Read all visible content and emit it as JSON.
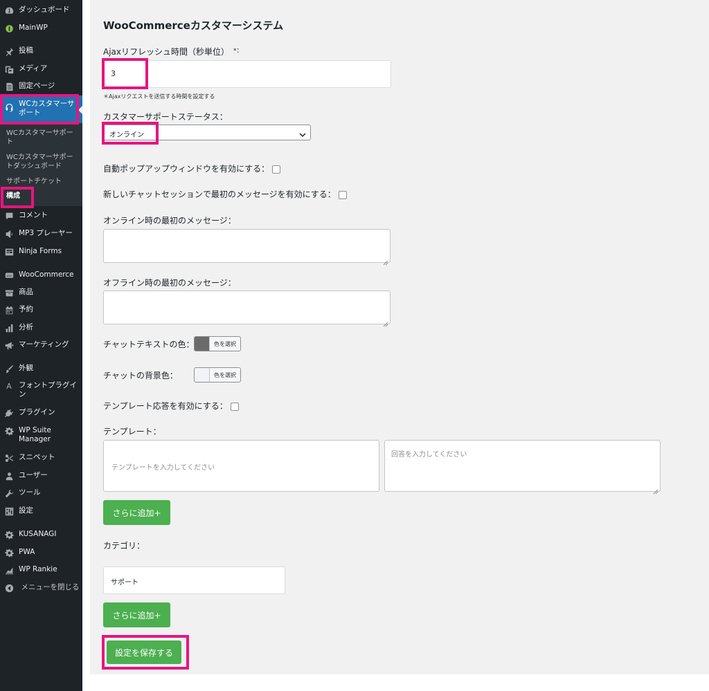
{
  "sidebar": {
    "items": [
      {
        "label": "ダッシュボード",
        "icon": "dashboard-icon"
      },
      {
        "label": "MainWP",
        "icon": "mainwp-icon"
      },
      {
        "label": "投稿",
        "icon": "pin-icon"
      },
      {
        "label": "メディア",
        "icon": "media-icon"
      },
      {
        "label": "固定ページ",
        "icon": "page-icon"
      },
      {
        "label": "WCカスタマーサポート",
        "icon": "headset-icon"
      },
      {
        "label": "コメント",
        "icon": "comment-icon"
      },
      {
        "label": "MP3 プレーヤー",
        "icon": "audio-icon"
      },
      {
        "label": "Ninja Forms",
        "icon": "forms-icon"
      },
      {
        "label": "WooCommerce",
        "icon": "woo-icon"
      },
      {
        "label": "商品",
        "icon": "archive-icon"
      },
      {
        "label": "予約",
        "icon": "calendar-icon"
      },
      {
        "label": "分析",
        "icon": "bar-chart-icon"
      },
      {
        "label": "マーケティング",
        "icon": "megaphone-icon"
      },
      {
        "label": "外観",
        "icon": "brush-icon"
      },
      {
        "label": "フォントプラグイン",
        "icon": "font-icon"
      },
      {
        "label": "プラグイン",
        "icon": "plugin-icon"
      },
      {
        "label": "WP Suite Manager",
        "icon": "gear-icon"
      },
      {
        "label": "スニペット",
        "icon": "scissors-icon"
      },
      {
        "label": "ユーザー",
        "icon": "user-icon"
      },
      {
        "label": "ツール",
        "icon": "wrench-icon"
      },
      {
        "label": "設定",
        "icon": "settings-icon"
      },
      {
        "label": "KUSANAGI",
        "icon": "gear-icon"
      },
      {
        "label": "PWA",
        "icon": "gear-icon"
      },
      {
        "label": "WP Rankie",
        "icon": "rank-chart-icon"
      },
      {
        "label": "メニューを閉じる",
        "icon": "collapse-icon"
      }
    ],
    "submenu": [
      {
        "label": "WCカスタマーサポート"
      },
      {
        "label": "WCカスタマーサポートダッシュボード"
      },
      {
        "label": "サポートチケット"
      },
      {
        "label": "構成"
      }
    ]
  },
  "main": {
    "title": "WooCommerceカスタマーシステム",
    "ajax": {
      "label": "Ajaxリフレッシュ時間（秒単位）",
      "required": "*：",
      "value": "3",
      "help": "＊Ajaxリクエストを送信する時間を設定する"
    },
    "status": {
      "label": "カスタマーサポートステータス：",
      "selected": "オンライン"
    },
    "auto_popup_label": "自動ポップアップウィンドウを有効にする：",
    "first_message_label": "新しいチャットセッションで最初のメッセージを有効にする：",
    "online_message_label": "オンライン時の最初のメッセージ：",
    "offline_message_label": "オフライン時の最初のメッセージ：",
    "chat_text_color": {
      "label": "チャットテキストの色：",
      "button": "色を選択",
      "swatch": "#6b6b6b"
    },
    "chat_bg_color": {
      "label": "チャットの背景色：",
      "button": "色を選択",
      "swatch": "#f1f3f6"
    },
    "template_enable_label": "テンプレート応答を有効にする：",
    "template": {
      "label": "テンプレート：",
      "template_placeholder": "テンプレートを入力してください",
      "answer_placeholder": "回答を入力してください"
    },
    "add_more_label": "さらに追加+",
    "category": {
      "label": "カテゴリ：",
      "value": "サポート"
    },
    "add_more_label_2": "さらに追加+",
    "save_label": "設定を保存する"
  },
  "colors": {
    "accent": "#2271b1",
    "highlight": "#e7157f",
    "button_green": "#4caf50",
    "sidebar_bg": "#1d2327"
  }
}
